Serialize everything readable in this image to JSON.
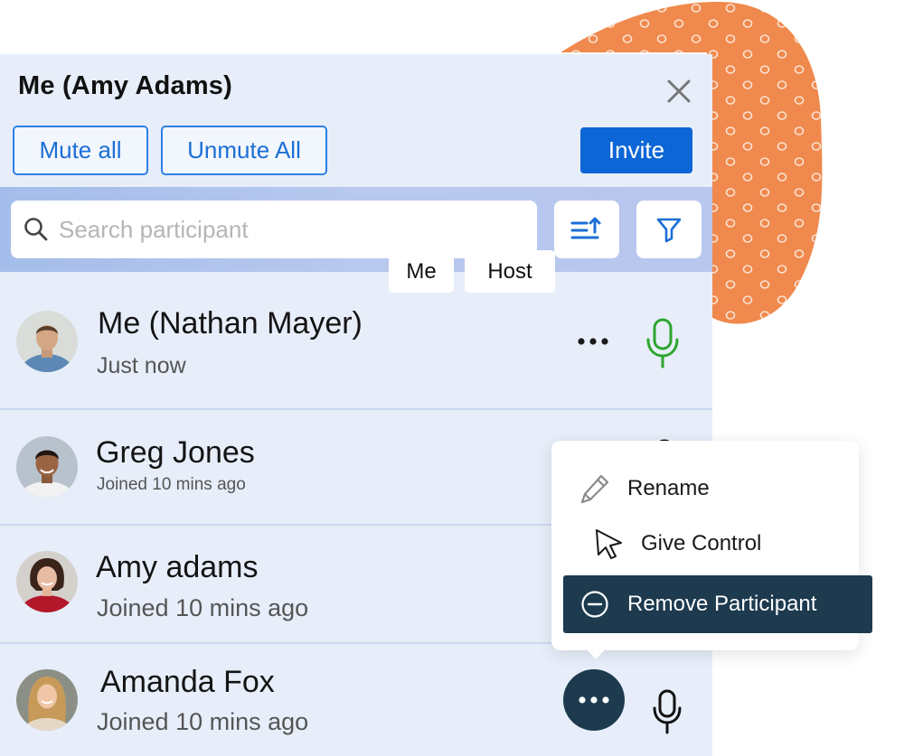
{
  "header": {
    "title": "Me (Amy Adams)",
    "close_icon": "close-icon"
  },
  "actions": {
    "mute_all": "Mute all",
    "unmute_all": "Unmute All",
    "invite": "Invite"
  },
  "search": {
    "placeholder": "Search participant",
    "value": "",
    "sort_icon": "sort-icon",
    "filter_icon": "filter-icon"
  },
  "participants": [
    {
      "name": "Me (Nathan Mayer)",
      "status": "Just now",
      "tags": [
        "Me",
        "Host"
      ],
      "mic": "on"
    },
    {
      "name": "Greg Jones",
      "status": "Joined 10 mins ago"
    },
    {
      "name": "Amy adams",
      "status": "Joined 10 mins ago"
    },
    {
      "name": "Amanda Fox",
      "status": "Joined 10 mins ago",
      "mic": "off"
    }
  ],
  "context_menu": {
    "items": [
      "Rename",
      "Give Control",
      "Remove Participant"
    ],
    "icons": [
      "pencil-icon",
      "cursor-icon",
      "minus-circle-icon"
    ]
  },
  "colors": {
    "panel": "#e7eefa",
    "accent": "#0d66d6",
    "dark": "#1d3a4f",
    "mic_active": "#2ea52e",
    "blob": "#f0894d"
  }
}
